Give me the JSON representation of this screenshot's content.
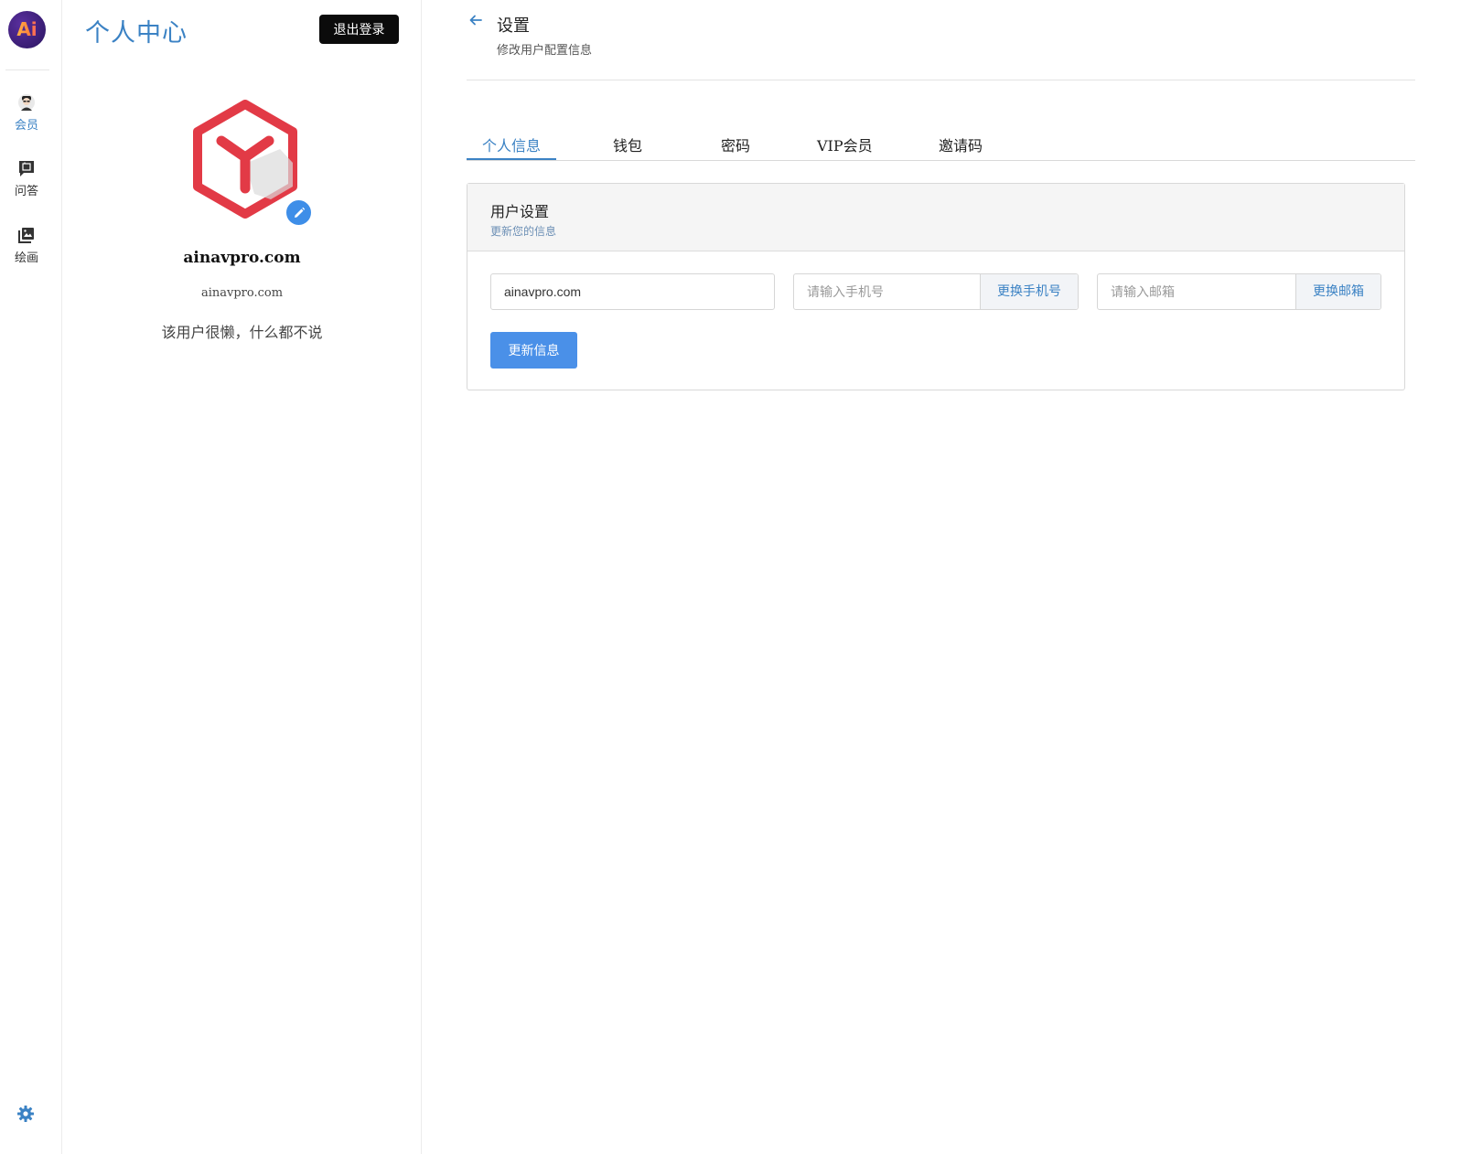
{
  "rail": {
    "logo_text": "Ai",
    "items": [
      {
        "label": "会员",
        "icon": "member-avatar-icon"
      },
      {
        "label": "问答",
        "icon": "chat-question-icon"
      },
      {
        "label": "绘画",
        "icon": "image-gallery-icon"
      }
    ],
    "settings_icon": "gear-icon",
    "accent": "#3b82c4"
  },
  "profile": {
    "title": "个人中心",
    "logout_label": "退出登录",
    "avatar_icon": "y-hexagon-avatar",
    "edit_icon": "pencil-icon",
    "name": "ainavpro.com",
    "account": "ainavpro.com",
    "bio": "该用户很懒，什么都不说"
  },
  "main": {
    "back_icon": "arrow-left-icon",
    "title": "设置",
    "subtitle": "修改用户配置信息",
    "tabs": [
      {
        "label": "个人信息",
        "active": true
      },
      {
        "label": "钱包",
        "active": false
      },
      {
        "label": "密码",
        "active": false
      },
      {
        "label": "VIP会员",
        "active": false
      },
      {
        "label": "邀请码",
        "active": false
      }
    ],
    "card": {
      "title": "用户设置",
      "subtitle": "更新您的信息",
      "username_value": "ainavpro.com",
      "phone_placeholder": "请输入手机号",
      "phone_button": "更换手机号",
      "email_placeholder": "请输入邮箱",
      "email_button": "更换邮箱",
      "submit_label": "更新信息"
    }
  }
}
